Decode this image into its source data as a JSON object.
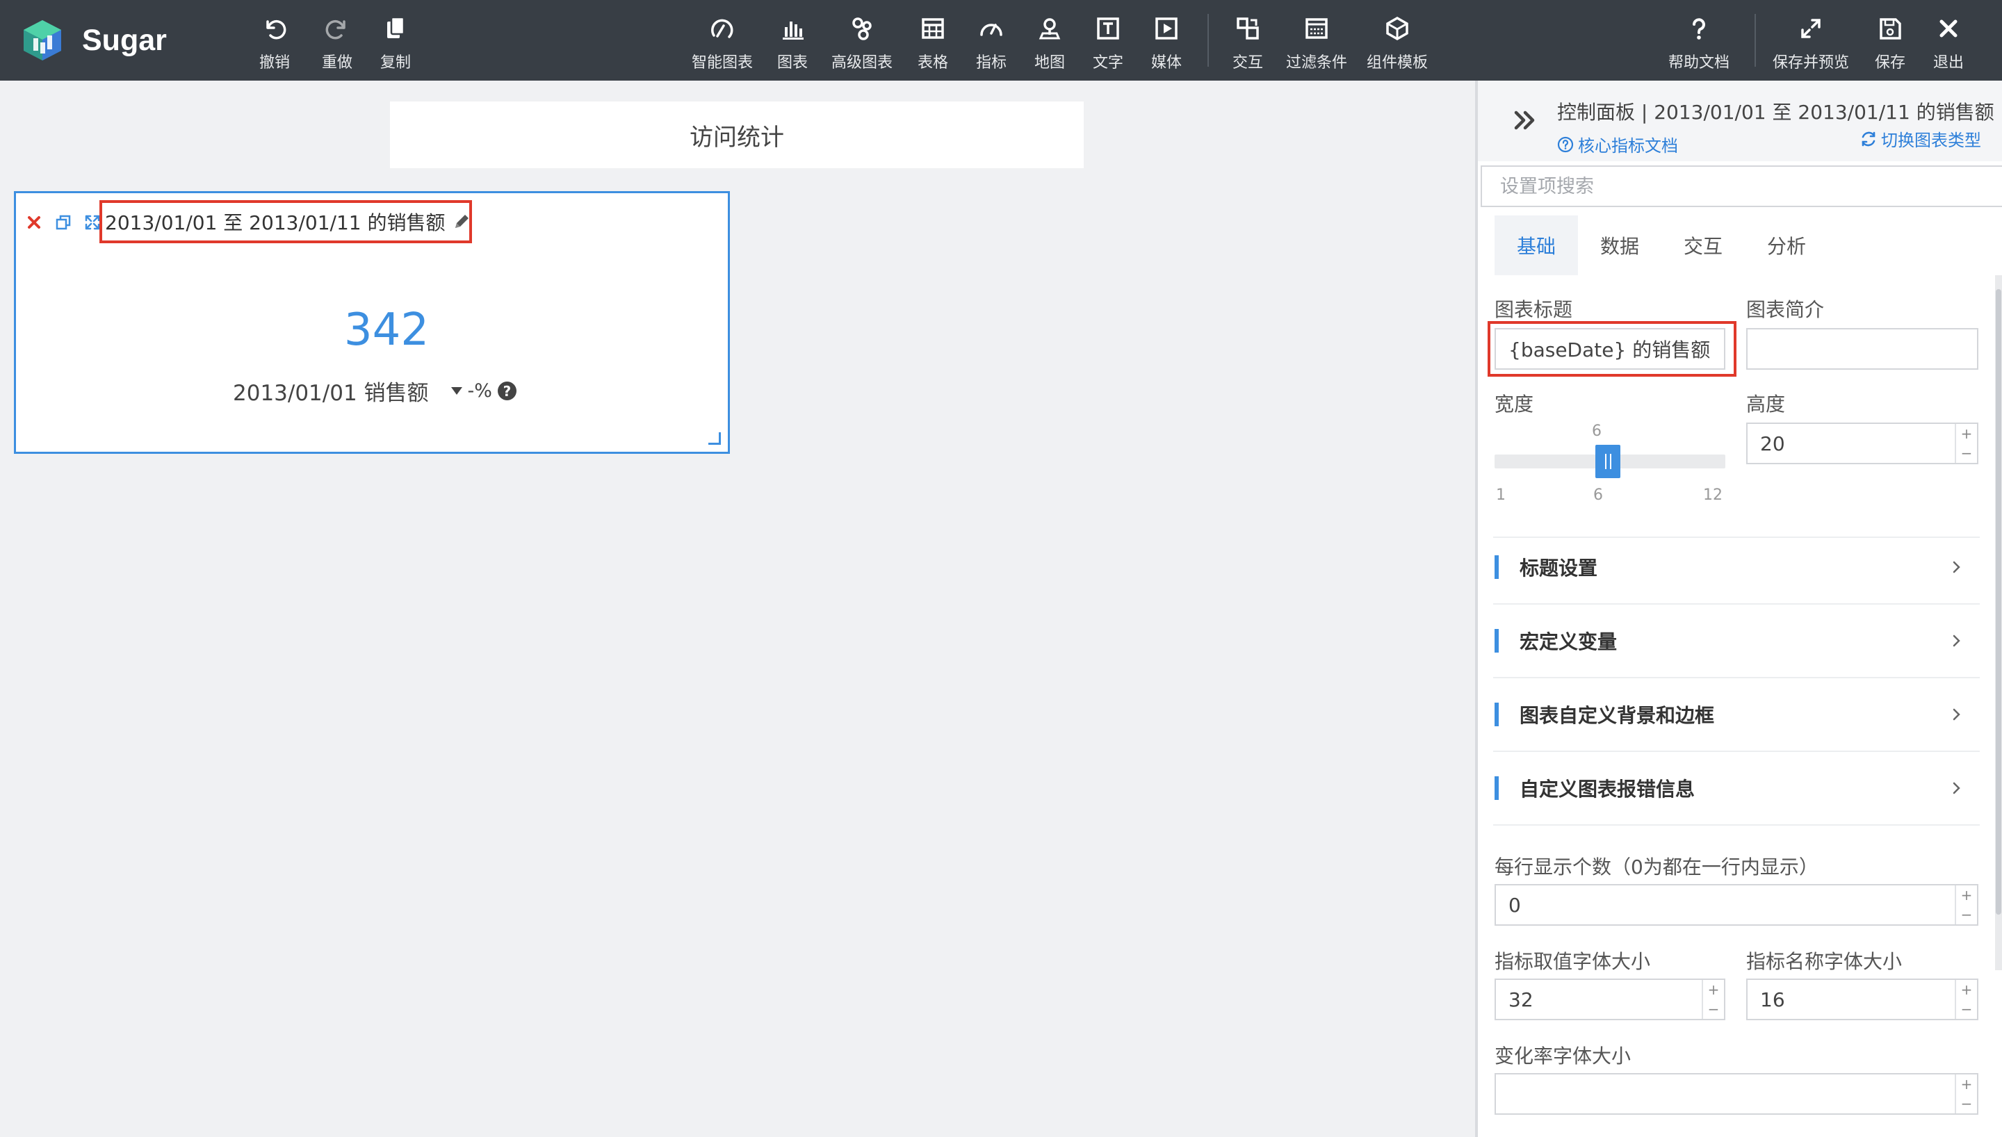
{
  "app": {
    "name": "Sugar"
  },
  "toolbar": {
    "undo": "撤销",
    "redo": "重做",
    "copy": "复制",
    "smart_chart": "智能图表",
    "chart": "图表",
    "advanced_chart": "高级图表",
    "table": "表格",
    "indicator": "指标",
    "map": "地图",
    "text": "文字",
    "media": "媒体",
    "interaction": "交互",
    "filter": "过滤条件",
    "component_template": "组件模板",
    "help": "帮助文档",
    "save_preview": "保存并预览",
    "save": "保存",
    "exit": "退出"
  },
  "canvas": {
    "page_title": "访问统计",
    "widget": {
      "title": "2013/01/01 至 2013/01/11 的销售额",
      "value": "342",
      "label": "2013/01/01 销售额",
      "change": "-%",
      "help": "?"
    }
  },
  "panel": {
    "title": "控制面板 | 2013/01/01 至 2013/01/11 的销售额",
    "doc_link": "核心指标文档",
    "switch_link": "切换图表类型",
    "search_placeholder": "设置项搜索",
    "tabs": [
      "基础",
      "数据",
      "交互",
      "分析"
    ],
    "active_tab": "基础",
    "fields": {
      "chart_title_label": "图表标题",
      "chart_title_value": "{baseDate} 的销售额",
      "chart_desc_label": "图表简介",
      "chart_desc_value": "",
      "width_label": "宽度",
      "width_value": 6,
      "width_current_label": "6",
      "width_min": "1",
      "width_mid": "6",
      "width_max": "12",
      "height_label": "高度",
      "height_value": "20",
      "per_row_label": "每行显示个数（0为都在一行内显示）",
      "per_row_value": "0",
      "value_font_label": "指标取值字体大小",
      "value_font_value": "32",
      "name_font_label": "指标名称字体大小",
      "name_font_value": "16",
      "change_font_label": "变化率字体大小",
      "change_font_value": ""
    },
    "sections": [
      "标题设置",
      "宏定义变量",
      "图表自定义背景和边框",
      "自定义图表报错信息"
    ]
  },
  "colors": {
    "topbar": "#383e45",
    "accent": "#3d8fe0",
    "highlight": "#e0392b",
    "delete_icon": "#e0392b"
  }
}
